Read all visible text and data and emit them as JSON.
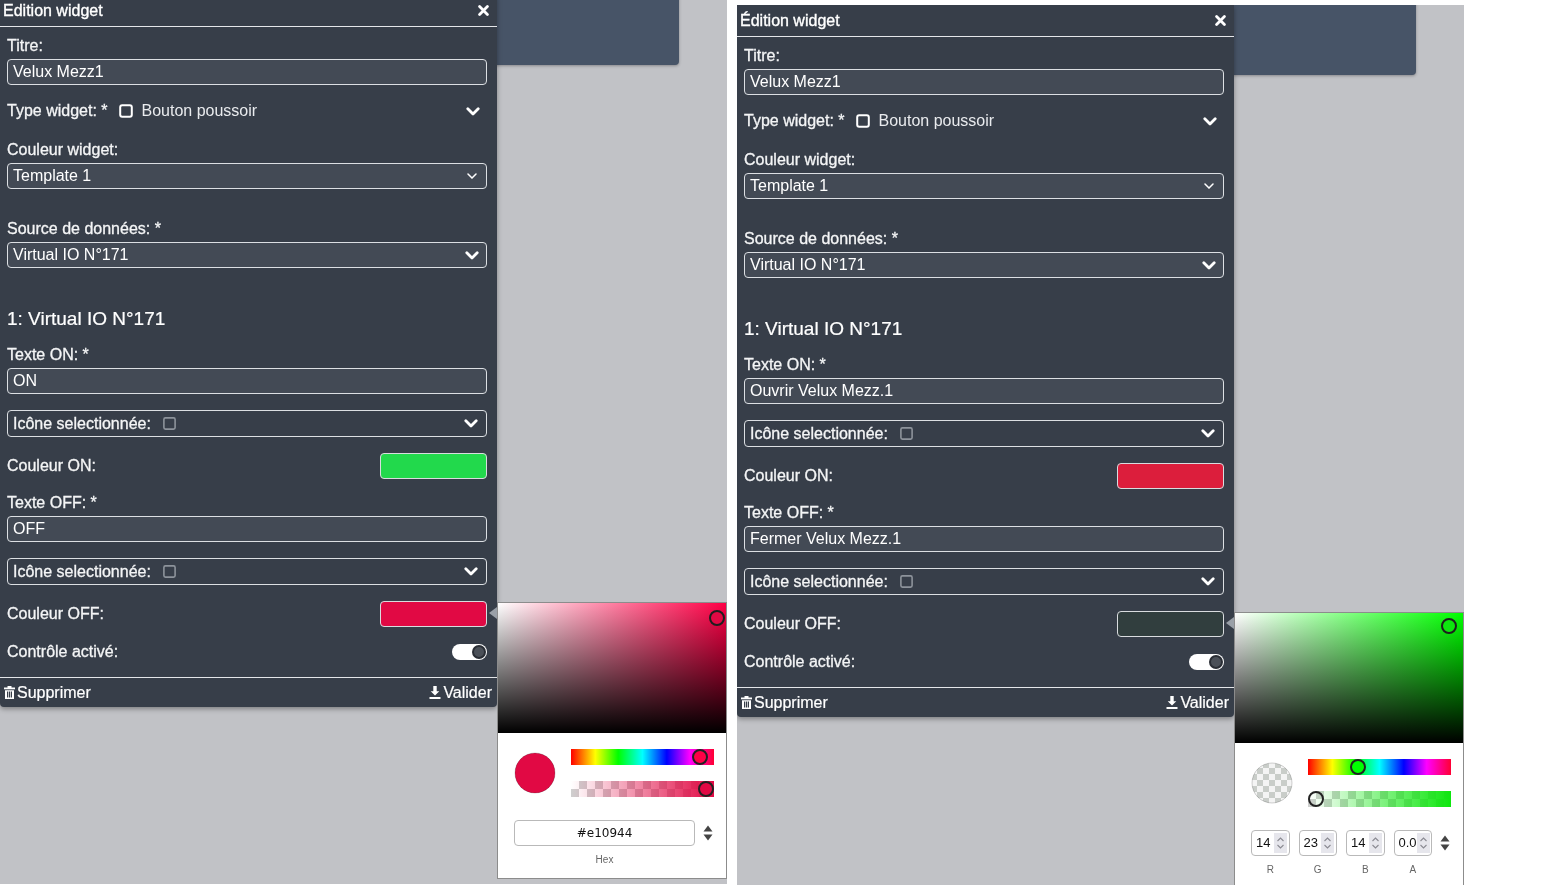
{
  "screens": [
    {
      "dialog": {
        "title": "Edition widget",
        "fields": [
          {
            "kind": "text",
            "label": "Titre:",
            "value": "Velux Mezz1"
          },
          {
            "kind": "type",
            "label": "Type widget: *",
            "value": "Bouton poussoir"
          },
          {
            "kind": "native",
            "label": "Couleur widget:",
            "value": "Template 1"
          },
          {
            "kind": "select",
            "label": "Source de données: *",
            "value": "Virtual IO N°171"
          },
          {
            "kind": "heading",
            "text": "1: Virtual IO N°171"
          },
          {
            "kind": "text",
            "label": "Texte ON: *",
            "value": "ON"
          },
          {
            "kind": "icon",
            "label": "Icône selectionnée:"
          },
          {
            "kind": "color",
            "label": "Couleur ON:",
            "color": "#22d94c"
          },
          {
            "kind": "text",
            "label": "Texte OFF: *",
            "value": "OFF"
          },
          {
            "kind": "icon",
            "label": "Icône selectionnée:"
          },
          {
            "kind": "color",
            "label": "Couleur OFF:",
            "color": "#e10944"
          },
          {
            "kind": "toggle",
            "label": "Contrôle activé:",
            "on": true
          }
        ],
        "buttons": [
          {
            "kind": "delete",
            "label": "Supprimer"
          },
          {
            "kind": "save",
            "label": "Valider"
          }
        ]
      },
      "picker": {
        "color": "#e10944",
        "hue": {
          "level": 0.95
        },
        "alpha": {
          "level": 1
        },
        "inputs": [
          {
            "kind": "hex",
            "label": "Hex",
            "value": "#e10944"
          }
        ]
      }
    },
    {
      "dialog": {
        "title": "Édition widget",
        "fields": [
          {
            "kind": "text",
            "label": "Titre:",
            "value": "Velux Mezz1"
          },
          {
            "kind": "type",
            "label": "Type widget: *",
            "value": "Bouton poussoir"
          },
          {
            "kind": "native",
            "label": "Couleur widget:",
            "value": "Template 1"
          },
          {
            "kind": "select",
            "label": "Source de données: *",
            "value": "Virtual IO N°171"
          },
          {
            "kind": "heading",
            "text": "1: Virtual IO N°171"
          },
          {
            "kind": "text",
            "label": "Texte ON: *",
            "value": "Ouvrir Velux Mezz.1"
          },
          {
            "kind": "icon",
            "label": "Icône selectionnée:"
          },
          {
            "kind": "color",
            "label": "Couleur ON:",
            "color": "#dc1e3c"
          },
          {
            "kind": "text",
            "label": "Texte OFF: *",
            "value": "Fermer Velux Mezz.1"
          },
          {
            "kind": "icon",
            "label": "Icône selectionnée:"
          },
          {
            "kind": "color",
            "label": "Couleur OFF:",
            "color": "#313e3e"
          },
          {
            "kind": "toggle",
            "label": "Contrôle activé:",
            "on": true
          }
        ],
        "buttons": [
          {
            "kind": "delete",
            "label": "Supprimer"
          },
          {
            "kind": "save",
            "label": "Valider"
          }
        ]
      },
      "picker": {
        "color": "#0ee60e",
        "hue": {
          "level": 0.33
        },
        "alpha": {
          "level": 0
        },
        "inputs": [
          {
            "kind": "number",
            "label": "R",
            "value": "14"
          },
          {
            "kind": "number",
            "label": "G",
            "value": "23"
          },
          {
            "kind": "number",
            "label": "B",
            "value": "14"
          },
          {
            "kind": "number",
            "label": "A",
            "value": "0.0"
          }
        ]
      }
    }
  ]
}
